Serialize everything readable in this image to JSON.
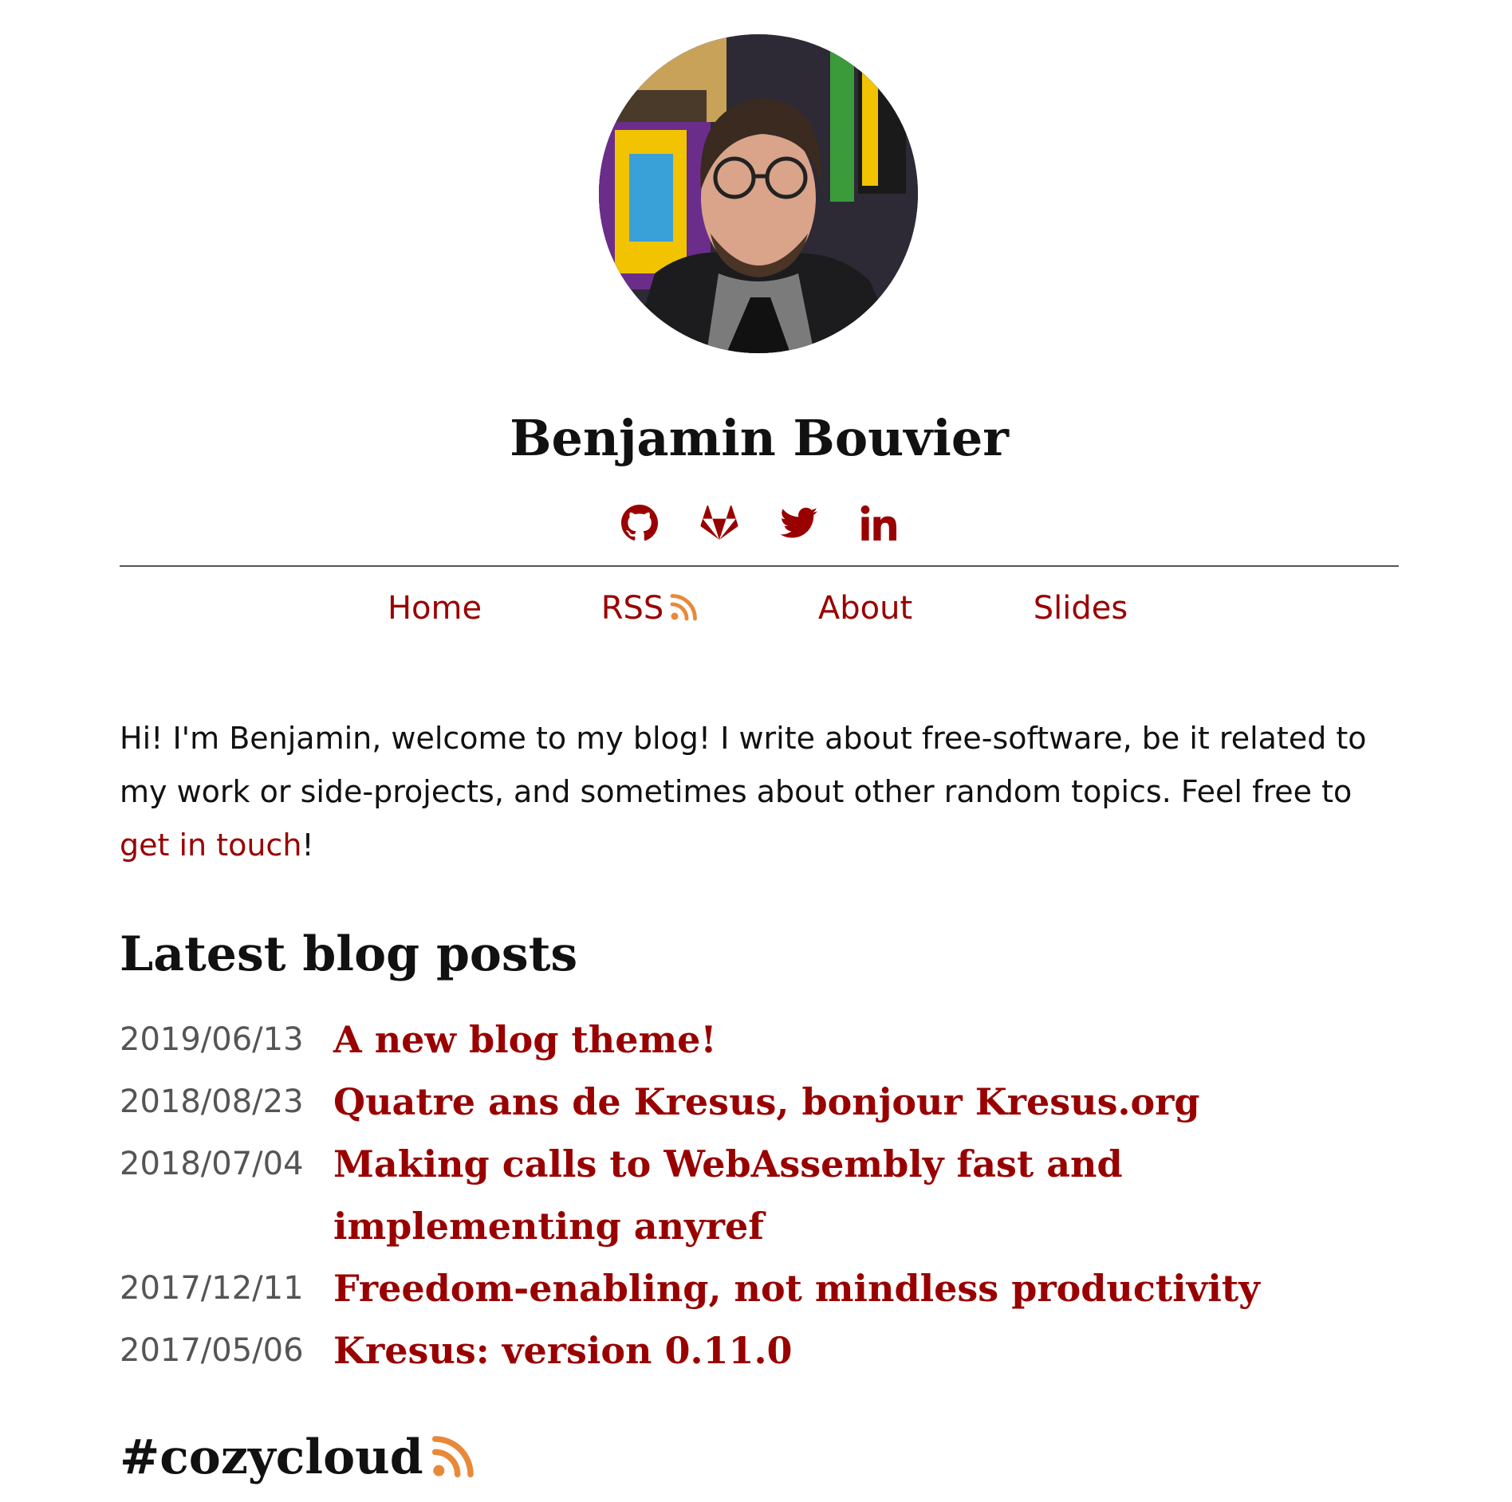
{
  "header": {
    "avatar_alt": "Benjamin Bouvier",
    "site_title": "Benjamin Bouvier",
    "social_links": [
      {
        "icon": "github-icon",
        "label": "GitHub"
      },
      {
        "icon": "gitlab-icon",
        "label": "GitLab"
      },
      {
        "icon": "twitter-icon",
        "label": "Twitter"
      },
      {
        "icon": "linkedin-icon",
        "label": "LinkedIn"
      }
    ]
  },
  "nav": {
    "items": [
      {
        "label": "Home"
      },
      {
        "label": "RSS",
        "icon": "rss-icon"
      },
      {
        "label": "About"
      },
      {
        "label": "Slides"
      }
    ]
  },
  "intro": {
    "text_before": "Hi! I'm Benjamin, welcome to my blog! I write about free-software, be it related to my work or side-projects, and sometimes about other random topics. Feel free to ",
    "link_text": "get in touch",
    "text_after": "!"
  },
  "latest_posts": {
    "heading": "Latest blog posts",
    "posts": [
      {
        "date": "2019/06/13",
        "title": "A new blog theme!"
      },
      {
        "date": "2018/08/23",
        "title": "Quatre ans de Kresus, bonjour Kresus.org"
      },
      {
        "date": "2018/07/04",
        "title": "Making calls to WebAssembly fast and implementing anyref"
      },
      {
        "date": "2017/12/11",
        "title": "Freedom-enabling, not mindless productivity"
      },
      {
        "date": "2017/05/06",
        "title": "Kresus: version 0.11.0"
      }
    ]
  },
  "tag_section": {
    "heading": "#cozycloud",
    "icon": "rss-icon"
  },
  "colors": {
    "accent": "#990000",
    "text": "#111111",
    "muted": "#555555",
    "rss": "#e8893a",
    "background": "#ffffff"
  }
}
